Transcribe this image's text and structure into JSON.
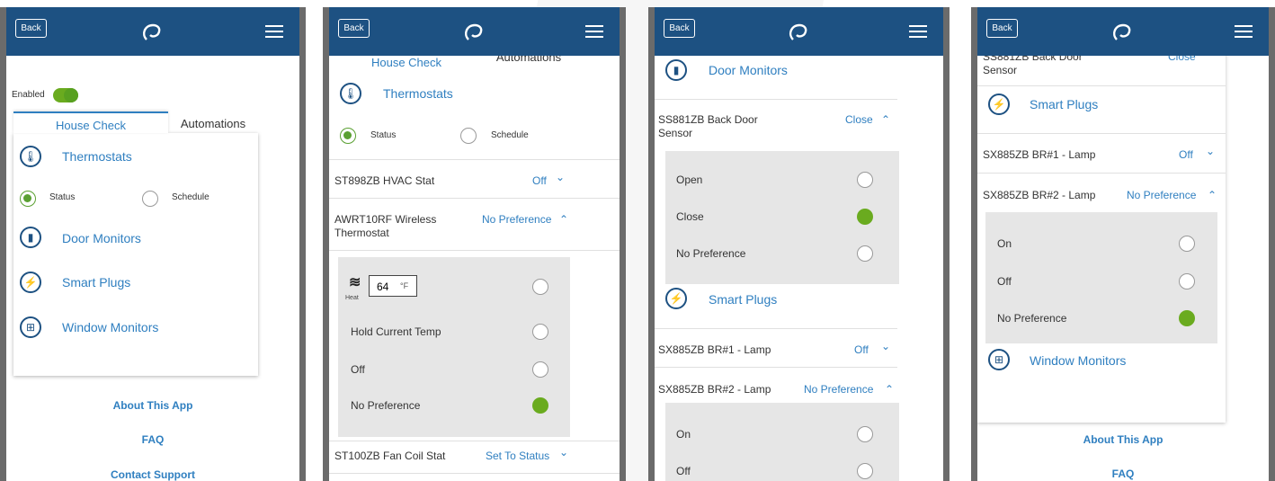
{
  "common": {
    "back": "Back"
  },
  "p1": {
    "enabled": "Enabled",
    "tab_house": "House Check",
    "tab_auto": "Automations",
    "thermostats": "Thermostats",
    "status": "Status",
    "schedule": "Schedule",
    "door": "Door Monitors",
    "plugs": "Smart Plugs",
    "window": "Window Monitors",
    "about": "About This App",
    "faq": "FAQ",
    "contact": "Contact Support"
  },
  "p2": {
    "tab_house": "House Check",
    "tab_auto": "Automations",
    "thermostats": "Thermostats",
    "status": "Status",
    "schedule": "Schedule",
    "dev1": "ST898ZB HVAC Stat",
    "dev1_val": "Off",
    "dev2": "AWRT10RF Wireless Thermostat",
    "dev2_val": "No Preference",
    "heat_temp": "64",
    "heat_unit": "°F",
    "heat_label": "Heat",
    "opt_hold": "Hold Current Temp",
    "opt_off": "Off",
    "opt_nopref": "No Preference",
    "dev3": "ST100ZB Fan Coil Stat",
    "dev3_val": "Set To Status"
  },
  "p3": {
    "door": "Door Monitors",
    "dev1": "SS881ZB Back Door Sensor",
    "dev1_val": "Close",
    "opt_open": "Open",
    "opt_close": "Close",
    "opt_nopref": "No Preference",
    "plugs": "Smart Plugs",
    "dev2": "SX885ZB BR#1 - Lamp",
    "dev2_val": "Off",
    "dev3": "SX885ZB BR#2 - Lamp",
    "dev3_val": "No Preference",
    "opt_on": "On",
    "opt_off": "Off"
  },
  "p4": {
    "dev0": "SS881ZB Back Door Sensor",
    "dev0_val": "Close",
    "plugs": "Smart Plugs",
    "dev1": "SX885ZB BR#1 - Lamp",
    "dev1_val": "Off",
    "dev2": "SX885ZB BR#2 - Lamp",
    "dev2_val": "No Preference",
    "opt_on": "On",
    "opt_off": "Off",
    "opt_nopref": "No Preference",
    "window": "Window Monitors",
    "about": "About This App",
    "faq": "FAQ"
  }
}
